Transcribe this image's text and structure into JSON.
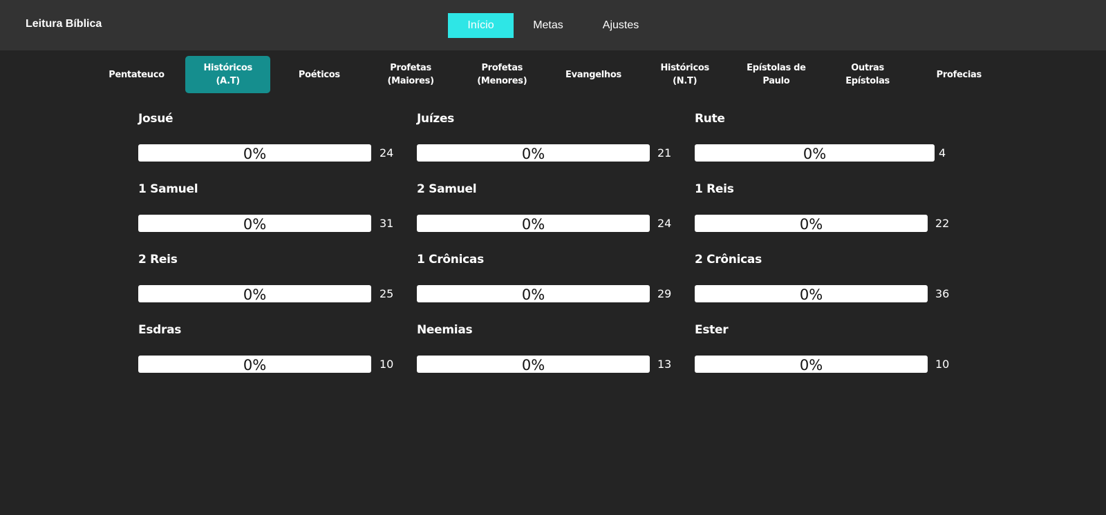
{
  "app": {
    "title": "Leitura Bíblica"
  },
  "nav": {
    "items": [
      {
        "label": "Início",
        "active": true
      },
      {
        "label": "Metas",
        "active": false
      },
      {
        "label": "Ajustes",
        "active": false
      }
    ]
  },
  "tabs": [
    {
      "lines": [
        "Pentateuco"
      ],
      "active": false
    },
    {
      "lines": [
        "Históricos",
        "(A.T)"
      ],
      "active": true
    },
    {
      "lines": [
        "Poéticos"
      ],
      "active": false
    },
    {
      "lines": [
        "Profetas",
        "(Maiores)"
      ],
      "active": false
    },
    {
      "lines": [
        "Profetas",
        "(Menores)"
      ],
      "active": false
    },
    {
      "lines": [
        "Evangelhos"
      ],
      "active": false
    },
    {
      "lines": [
        "Históricos",
        "(N.T)"
      ],
      "active": false
    },
    {
      "lines": [
        "Epístolas de",
        "Paulo"
      ],
      "active": false
    },
    {
      "lines": [
        "Outras",
        "Epístolas"
      ],
      "active": false
    },
    {
      "lines": [
        "Profecias"
      ],
      "active": false
    }
  ],
  "books": [
    {
      "name": "Josué",
      "progress_text": "0%",
      "progress": 0,
      "chapters": "24"
    },
    {
      "name": "Juízes",
      "progress_text": "0%",
      "progress": 0,
      "chapters": "21"
    },
    {
      "name": "Rute",
      "progress_text": "0%",
      "progress": 0,
      "chapters": "4"
    },
    {
      "name": "1 Samuel",
      "progress_text": "0%",
      "progress": 0,
      "chapters": "31"
    },
    {
      "name": "2 Samuel",
      "progress_text": "0%",
      "progress": 0,
      "chapters": "24"
    },
    {
      "name": "1 Reis",
      "progress_text": "0%",
      "progress": 0,
      "chapters": "22"
    },
    {
      "name": "2 Reis",
      "progress_text": "0%",
      "progress": 0,
      "chapters": "25"
    },
    {
      "name": "1 Crônicas",
      "progress_text": "0%",
      "progress": 0,
      "chapters": "29"
    },
    {
      "name": "2 Crônicas",
      "progress_text": "0%",
      "progress": 0,
      "chapters": "36"
    },
    {
      "name": "Esdras",
      "progress_text": "0%",
      "progress": 0,
      "chapters": "10"
    },
    {
      "name": "Neemias",
      "progress_text": "0%",
      "progress": 0,
      "chapters": "13"
    },
    {
      "name": "Ester",
      "progress_text": "0%",
      "progress": 0,
      "chapters": "10"
    }
  ],
  "colors": {
    "background": "#242424",
    "topbar": "#333333",
    "accent": "#2ee6e6",
    "tab_active": "#158e8e"
  }
}
